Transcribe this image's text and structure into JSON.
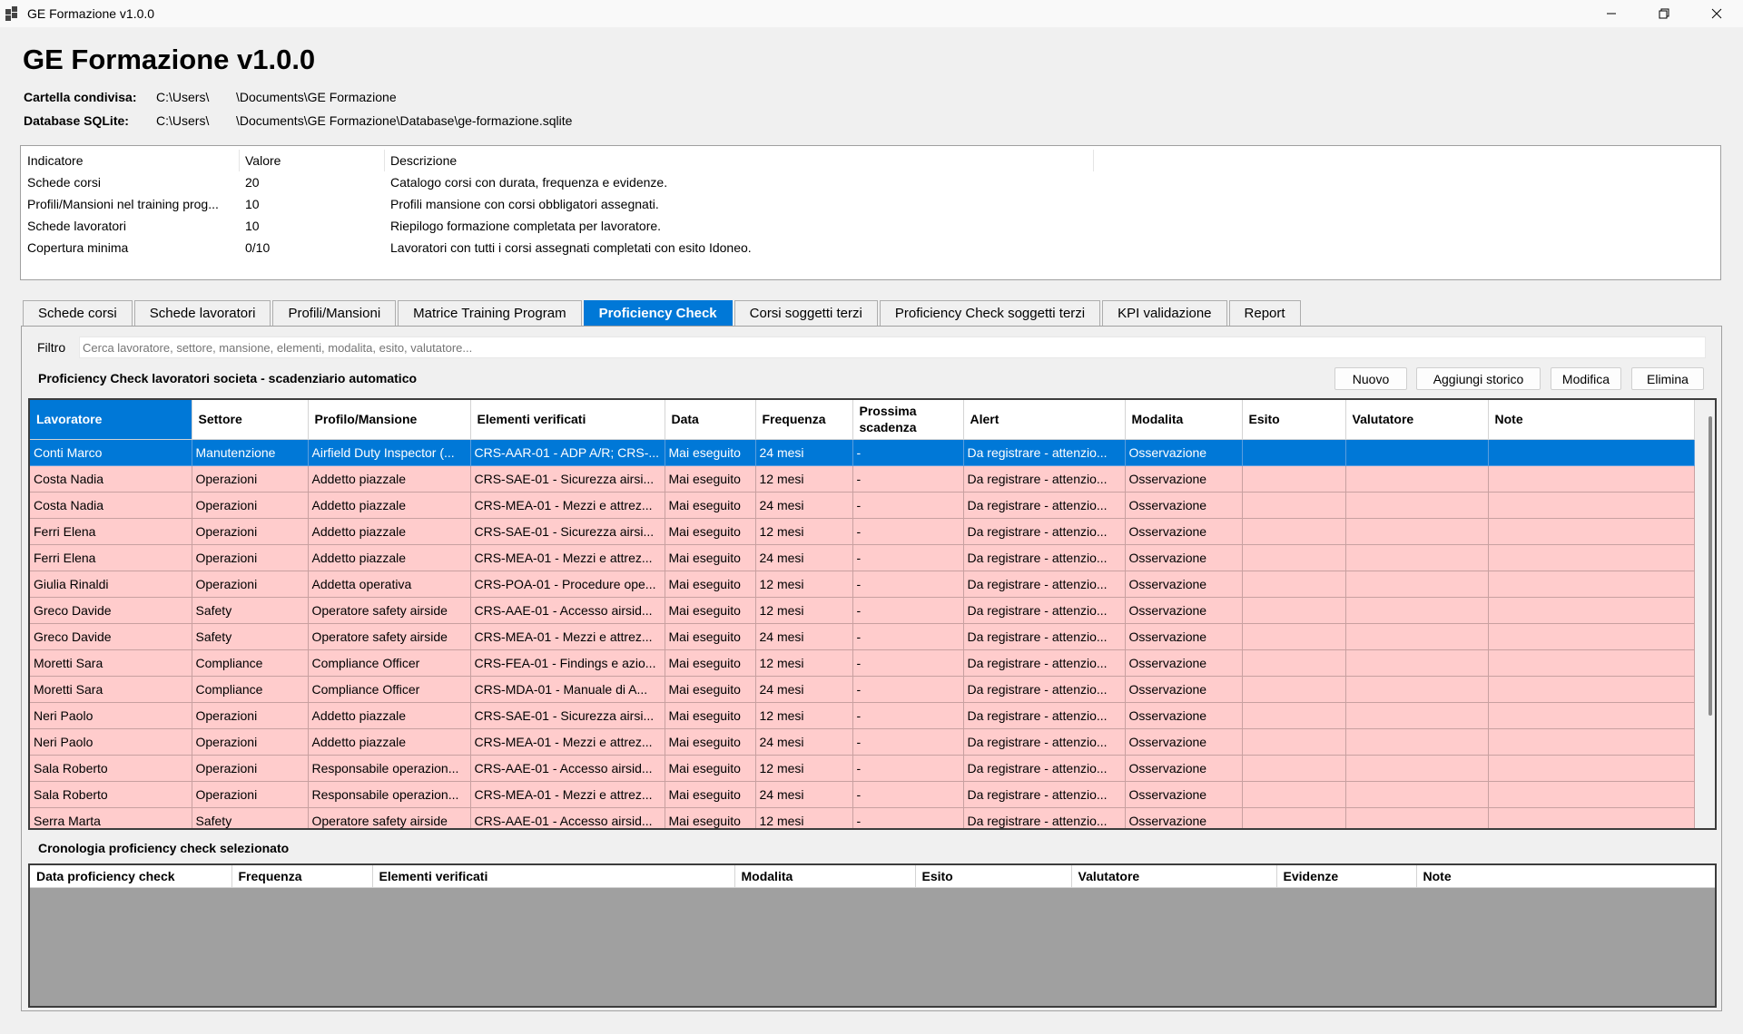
{
  "window": {
    "title": "GE Formazione v1.0.0"
  },
  "header": {
    "title": "GE Formazione v1.0.0",
    "shared_folder": {
      "label": "Cartella condivisa:",
      "part1": "C:\\Users\\",
      "part2": "\\Documents\\GE Formazione"
    },
    "database": {
      "label": "Database SQLite:",
      "part1": "C:\\Users\\",
      "part2": "\\Documents\\GE Formazione\\Database\\ge-formazione.sqlite"
    }
  },
  "kpi": {
    "headers": [
      "Indicatore",
      "Valore",
      "Descrizione"
    ],
    "rows": [
      [
        "Schede corsi",
        "20",
        "Catalogo corsi con durata, frequenza e evidenze."
      ],
      [
        "Profili/Mansioni nel training prog...",
        "10",
        "Profili mansione con corsi obbligatori assegnati."
      ],
      [
        "Schede lavoratori",
        "10",
        "Riepilogo formazione completata per lavoratore."
      ],
      [
        "Copertura minima",
        "0/10",
        "Lavoratori con tutti i corsi assegnati completati con esito Idoneo."
      ]
    ]
  },
  "tabs": [
    {
      "label": "Schede corsi",
      "active": false
    },
    {
      "label": "Schede lavoratori",
      "active": false
    },
    {
      "label": "Profili/Mansioni",
      "active": false
    },
    {
      "label": "Matrice Training Program",
      "active": false
    },
    {
      "label": "Proficiency Check",
      "active": true
    },
    {
      "label": "Corsi soggetti terzi",
      "active": false
    },
    {
      "label": "Proficiency Check soggetti terzi",
      "active": false
    },
    {
      "label": "KPI validazione",
      "active": false
    },
    {
      "label": "Report",
      "active": false
    }
  ],
  "filter": {
    "label": "Filtro",
    "placeholder": "Cerca lavoratore, settore, mansione, elementi, modalita, esito, valutatore..."
  },
  "grid": {
    "caption": "Proficiency Check lavoratori societa - scadenziario automatico",
    "buttons": {
      "new": "Nuovo",
      "add_history": "Aggiungi storico",
      "edit": "Modifica",
      "delete": "Elimina"
    },
    "columns": [
      "Lavoratore",
      "Settore",
      "Profilo/Mansione",
      "Elementi verificati",
      "Data",
      "Frequenza",
      "Prossima scadenza",
      "Alert",
      "Modalita",
      "Esito",
      "Valutatore",
      "Note"
    ],
    "rows": [
      [
        "Conti Marco",
        "Manutenzione",
        "Airfield Duty Inspector (...",
        "CRS-AAR-01 - ADP A/R; CRS-...",
        "Mai eseguito",
        "24 mesi",
        "-",
        "Da registrare - attenzio...",
        "Osservazione",
        "",
        "",
        ""
      ],
      [
        "Costa Nadia",
        "Operazioni",
        "Addetto piazzale",
        "CRS-SAE-01 - Sicurezza airsi...",
        "Mai eseguito",
        "12 mesi",
        "-",
        "Da registrare - attenzio...",
        "Osservazione",
        "",
        "",
        ""
      ],
      [
        "Costa Nadia",
        "Operazioni",
        "Addetto piazzale",
        "CRS-MEA-01 - Mezzi e attrez...",
        "Mai eseguito",
        "24 mesi",
        "-",
        "Da registrare - attenzio...",
        "Osservazione",
        "",
        "",
        ""
      ],
      [
        "Ferri Elena",
        "Operazioni",
        "Addetto piazzale",
        "CRS-SAE-01 - Sicurezza airsi...",
        "Mai eseguito",
        "12 mesi",
        "-",
        "Da registrare - attenzio...",
        "Osservazione",
        "",
        "",
        ""
      ],
      [
        "Ferri Elena",
        "Operazioni",
        "Addetto piazzale",
        "CRS-MEA-01 - Mezzi e attrez...",
        "Mai eseguito",
        "24 mesi",
        "-",
        "Da registrare - attenzio...",
        "Osservazione",
        "",
        "",
        ""
      ],
      [
        "Giulia Rinaldi",
        "Operazioni",
        "Addetta operativa",
        "CRS-POA-01 - Procedure ope...",
        "Mai eseguito",
        "12 mesi",
        "-",
        "Da registrare - attenzio...",
        "Osservazione",
        "",
        "",
        ""
      ],
      [
        "Greco Davide",
        "Safety",
        "Operatore safety airside",
        "CRS-AAE-01 - Accesso airsid...",
        "Mai eseguito",
        "12 mesi",
        "-",
        "Da registrare - attenzio...",
        "Osservazione",
        "",
        "",
        ""
      ],
      [
        "Greco Davide",
        "Safety",
        "Operatore safety airside",
        "CRS-MEA-01 - Mezzi e attrez...",
        "Mai eseguito",
        "24 mesi",
        "-",
        "Da registrare - attenzio...",
        "Osservazione",
        "",
        "",
        ""
      ],
      [
        "Moretti Sara",
        "Compliance",
        "Compliance Officer",
        "CRS-FEA-01 - Findings e azio...",
        "Mai eseguito",
        "12 mesi",
        "-",
        "Da registrare - attenzio...",
        "Osservazione",
        "",
        "",
        ""
      ],
      [
        "Moretti Sara",
        "Compliance",
        "Compliance Officer",
        "CRS-MDA-01 - Manuale di A...",
        "Mai eseguito",
        "24 mesi",
        "-",
        "Da registrare - attenzio...",
        "Osservazione",
        "",
        "",
        ""
      ],
      [
        "Neri Paolo",
        "Operazioni",
        "Addetto piazzale",
        "CRS-SAE-01 - Sicurezza airsi...",
        "Mai eseguito",
        "12 mesi",
        "-",
        "Da registrare - attenzio...",
        "Osservazione",
        "",
        "",
        ""
      ],
      [
        "Neri Paolo",
        "Operazioni",
        "Addetto piazzale",
        "CRS-MEA-01 - Mezzi e attrez...",
        "Mai eseguito",
        "24 mesi",
        "-",
        "Da registrare - attenzio...",
        "Osservazione",
        "",
        "",
        ""
      ],
      [
        "Sala Roberto",
        "Operazioni",
        "Responsabile operazion...",
        "CRS-AAE-01 - Accesso airsid...",
        "Mai eseguito",
        "12 mesi",
        "-",
        "Da registrare - attenzio...",
        "Osservazione",
        "",
        "",
        ""
      ],
      [
        "Sala Roberto",
        "Operazioni",
        "Responsabile operazion...",
        "CRS-MEA-01 - Mezzi e attrez...",
        "Mai eseguito",
        "24 mesi",
        "-",
        "Da registrare - attenzio...",
        "Osservazione",
        "",
        "",
        ""
      ],
      [
        "Serra Marta",
        "Safety",
        "Operatore safety airside",
        "CRS-AAE-01 - Accesso airsid...",
        "Mai eseguito",
        "12 mesi",
        "-",
        "Da registrare - attenzio...",
        "Osservazione",
        "",
        "",
        ""
      ]
    ]
  },
  "history": {
    "caption": "Cronologia proficiency check selezionato",
    "columns": [
      "Data proficiency check",
      "Frequenza",
      "Elementi verificati",
      "Modalita",
      "Esito",
      "Valutatore",
      "Evidenze",
      "Note"
    ]
  },
  "colors": {
    "accent": "#0078d7",
    "row_alert": "#ffcccc",
    "history_bg": "#a0a0a0"
  },
  "icons": {
    "app": "app-window-icon",
    "minimize": "minimize-icon",
    "restore": "restore-icon",
    "close": "close-icon"
  }
}
